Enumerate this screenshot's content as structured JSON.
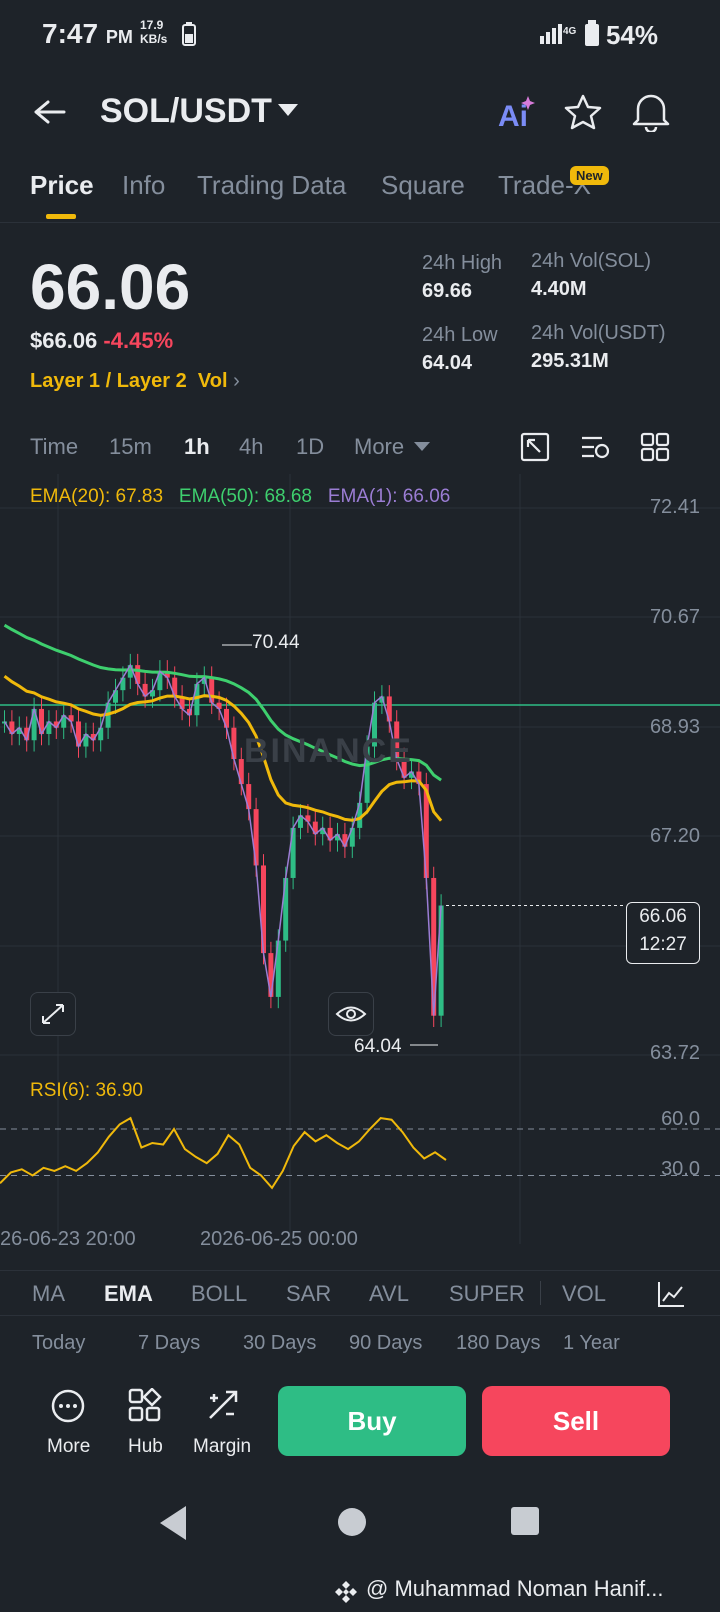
{
  "status": {
    "time": "7:47",
    "ampm": "PM",
    "speed_value": "17.9",
    "speed_unit": "KB/s",
    "battery": "54%",
    "network": "4G"
  },
  "header": {
    "pair": "SOL/USDT"
  },
  "tabs": [
    {
      "label": "Price"
    },
    {
      "label": "Info"
    },
    {
      "label": "Trading Data"
    },
    {
      "label": "Square"
    },
    {
      "label": "Trade-X"
    }
  ],
  "new_badge": "New",
  "price": {
    "last": "66.06",
    "usd": "$66.06",
    "change": "-4.45%"
  },
  "tags": {
    "category": "Layer 1 / Layer 2",
    "vol": "Vol"
  },
  "stats": {
    "high_label": "24h High",
    "high_value": "69.66",
    "low_label": "24h Low",
    "low_value": "64.04",
    "vol_sol_label": "24h Vol(SOL)",
    "vol_sol_value": "4.40M",
    "vol_usdt_label": "24h Vol(USDT)",
    "vol_usdt_value": "295.31M"
  },
  "intervals": [
    {
      "label": "Time"
    },
    {
      "label": "15m"
    },
    {
      "label": "1h"
    },
    {
      "label": "4h"
    },
    {
      "label": "1D"
    },
    {
      "label": "More"
    }
  ],
  "ema_legend": {
    "ema20": "EMA(20): 67.83",
    "ema50": "EMA(50): 68.68",
    "ema1": "EMA(1): 66.06"
  },
  "colors": {
    "up": "#2ebd85",
    "down": "#f6465d",
    "ema20": "#f0b90b",
    "ema50": "#3ecf6e",
    "ema1": "#9b7dd4",
    "brand": "#f0b90b"
  },
  "chart_data": {
    "type": "candlestick",
    "y_axis_ticks": [
      "72.41",
      "70.67",
      "68.93",
      "67.20",
      "63.72"
    ],
    "x_axis_ticks": [
      "26-06-23 20:00",
      "2026-06-25 00:00"
    ],
    "high_marker": "70.44",
    "low_marker": "64.04",
    "current_price": "66.06",
    "countdown": "12:27",
    "watermark": "BINANCE",
    "ylim": [
      63.72,
      72.41
    ],
    "closes": [
      69.0,
      68.8,
      68.9,
      68.7,
      69.2,
      68.8,
      69.0,
      68.9,
      69.1,
      69.0,
      68.6,
      68.8,
      68.7,
      68.9,
      69.3,
      69.5,
      69.7,
      69.9,
      69.6,
      69.4,
      69.5,
      69.8,
      69.7,
      69.4,
      69.2,
      69.1,
      69.6,
      69.7,
      69.3,
      69.2,
      68.9,
      68.4,
      68.0,
      67.6,
      66.7,
      65.3,
      64.6,
      65.5,
      66.5,
      67.3,
      67.5,
      67.4,
      67.2,
      67.3,
      67.1,
      67.2,
      67.0,
      67.3,
      67.7,
      68.6,
      69.3,
      69.4,
      69.0,
      68.4,
      68.1,
      68.2,
      68.0,
      66.5,
      64.3,
      66.06
    ],
    "rsi": {
      "label": "RSI(6): 36.90",
      "levels": [
        "60.0",
        "30.0"
      ],
      "values": [
        25,
        32,
        34,
        30,
        35,
        33,
        36,
        33,
        38,
        45,
        55,
        63,
        67,
        48,
        51,
        50,
        60,
        47,
        42,
        38,
        44,
        56,
        50,
        35,
        30,
        22,
        33,
        49,
        58,
        52,
        56,
        51,
        47,
        52,
        60,
        67,
        66,
        58,
        48,
        41,
        45,
        40
      ]
    }
  },
  "indicator_tabs": [
    {
      "label": "MA"
    },
    {
      "label": "EMA"
    },
    {
      "label": "BOLL"
    },
    {
      "label": "SAR"
    },
    {
      "label": "AVL"
    },
    {
      "label": "SUPER"
    },
    {
      "label": "VOL"
    }
  ],
  "performance": [
    {
      "label": "Today"
    },
    {
      "label": "7 Days"
    },
    {
      "label": "30 Days"
    },
    {
      "label": "90 Days"
    },
    {
      "label": "180 Days"
    },
    {
      "label": "1 Year"
    }
  ],
  "bottom": {
    "more": "More",
    "hub": "Hub",
    "margin": "Margin",
    "buy": "Buy",
    "sell": "Sell"
  },
  "watermark_text": "@ Muhammad Noman Hanif..."
}
